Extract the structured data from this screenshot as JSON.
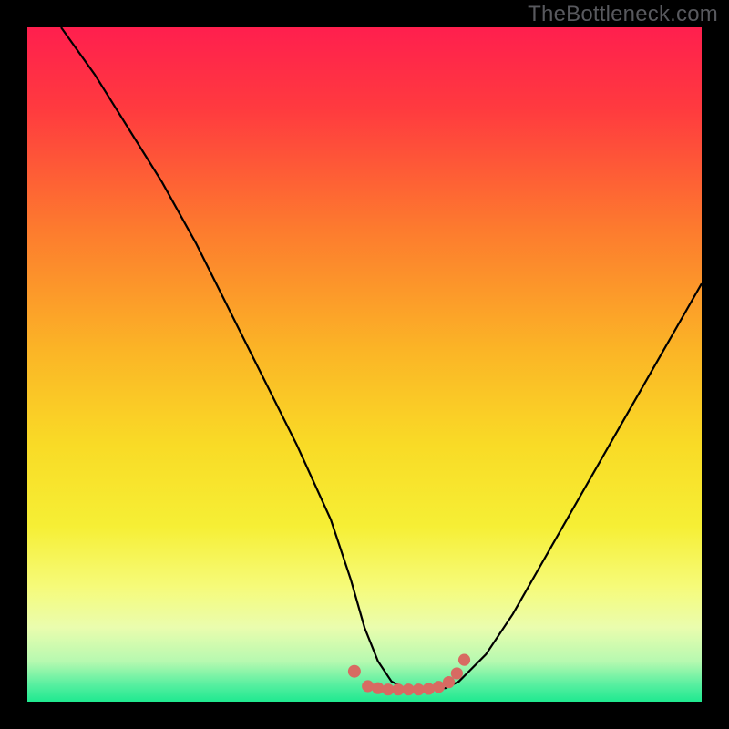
{
  "watermark": "TheBottleneck.com",
  "chart_data": {
    "type": "line",
    "title": "",
    "xlabel": "",
    "ylabel": "",
    "xlim": [
      0,
      100
    ],
    "ylim": [
      0,
      100
    ],
    "grid": false,
    "legend": false,
    "series": [
      {
        "name": "bottleneck-curve",
        "x": [
          5,
          10,
          15,
          20,
          25,
          30,
          35,
          40,
          45,
          48,
          50,
          52,
          54,
          56,
          58,
          60,
          62,
          64,
          68,
          72,
          76,
          80,
          84,
          88,
          92,
          96,
          100
        ],
        "y": [
          100,
          93,
          85,
          77,
          68,
          58,
          48,
          38,
          27,
          18,
          11,
          6,
          3,
          2,
          2,
          2,
          2,
          3,
          7,
          13,
          20,
          27,
          34,
          41,
          48,
          55,
          62
        ]
      }
    ],
    "markers": {
      "name": "sweet-spot-dots",
      "color": "#d86a62",
      "x": [
        48.5,
        50.5,
        52,
        53.5,
        55,
        56.5,
        58,
        59.5,
        61,
        62.5,
        63.7,
        64.8
      ],
      "y": [
        4.5,
        2.3,
        2.0,
        1.8,
        1.8,
        1.8,
        1.8,
        1.9,
        2.2,
        2.9,
        4.2,
        6.2
      ]
    },
    "background_gradient": {
      "stops": [
        {
          "offset": 0.0,
          "color": "#ff1f4e"
        },
        {
          "offset": 0.12,
          "color": "#ff3a3f"
        },
        {
          "offset": 0.3,
          "color": "#fd7b2e"
        },
        {
          "offset": 0.48,
          "color": "#fbb526"
        },
        {
          "offset": 0.62,
          "color": "#f9db26"
        },
        {
          "offset": 0.74,
          "color": "#f6ef35"
        },
        {
          "offset": 0.83,
          "color": "#f6fb7a"
        },
        {
          "offset": 0.89,
          "color": "#eafdae"
        },
        {
          "offset": 0.94,
          "color": "#b7f9b0"
        },
        {
          "offset": 0.975,
          "color": "#57efa0"
        },
        {
          "offset": 1.0,
          "color": "#1fe990"
        }
      ]
    }
  }
}
